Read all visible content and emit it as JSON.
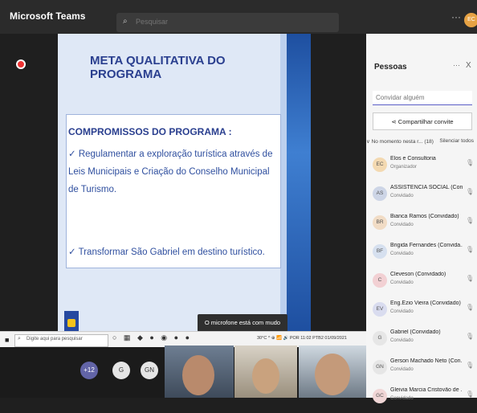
{
  "app": {
    "title": "Microsoft Teams",
    "search_placeholder": "Pesquisar",
    "more": "···",
    "avatar": "EC"
  },
  "slide": {
    "title": "META QUALITATIVA DO PROGRAMA",
    "section_title": "COMPROMISSOS DO PROGRAMA :",
    "item1": "✓ Regulamentar a exploração turística através de Leis Municipais e Criação do Conselho Municipal de Turismo.",
    "item2": "✓ Transformar São Gabriel em destino turístico."
  },
  "toast": "O microfone está com mudo ativado.",
  "taskbar": {
    "search_placeholder": "Digite aqui para pesquisar",
    "tray": "30°C ^ ⊕ 📶 🔊 POR 11:02 PTB2 01/09/2021"
  },
  "participants_strip": [
    {
      "label": "+12"
    },
    {
      "label": "G"
    },
    {
      "label": "GN"
    }
  ],
  "panel": {
    "title": "Pessoas",
    "more": "···",
    "close": "X",
    "invite_placeholder": "Convidar alguém",
    "share_label": "Compartilhar convite",
    "section_label": "∨ No momento nesta r... (18)",
    "mute_all": "Silenciar todos",
    "people": [
      {
        "initials": "EC",
        "name": "Elos e Consultoria",
        "role": "Organizador",
        "color": "#f3d9b1"
      },
      {
        "initials": "AS",
        "name": "ASSISTENCIA SOCIAL (Convi...",
        "role": "Convidado",
        "color": "#cdd5e6"
      },
      {
        "initials": "BR",
        "name": "Bianca Ramos (Convidado)",
        "role": "Convidado",
        "color": "#f1dcc5"
      },
      {
        "initials": "BF",
        "name": "Brigida Fernandes (Convida...",
        "role": "Convidado",
        "color": "#d6e0ef"
      },
      {
        "initials": "C",
        "name": "Cleveson (Convidado)",
        "role": "Convidado",
        "color": "#f2d0d3"
      },
      {
        "initials": "EV",
        "name": "Eng.Ezio Vieira (Convidado)",
        "role": "Convidado",
        "color": "#d9dcef"
      },
      {
        "initials": "G",
        "name": "Gabriel (Convidado)",
        "role": "Convidado",
        "color": "#e6e6e6"
      },
      {
        "initials": "GN",
        "name": "Gerson Machado Neto (Con...",
        "role": "Convidado",
        "color": "#e6e6e6"
      },
      {
        "initials": "GC",
        "name": "Gleivia Marcia Cristovão de ...",
        "role": "Convidado",
        "color": "#f0d6d6"
      }
    ]
  }
}
